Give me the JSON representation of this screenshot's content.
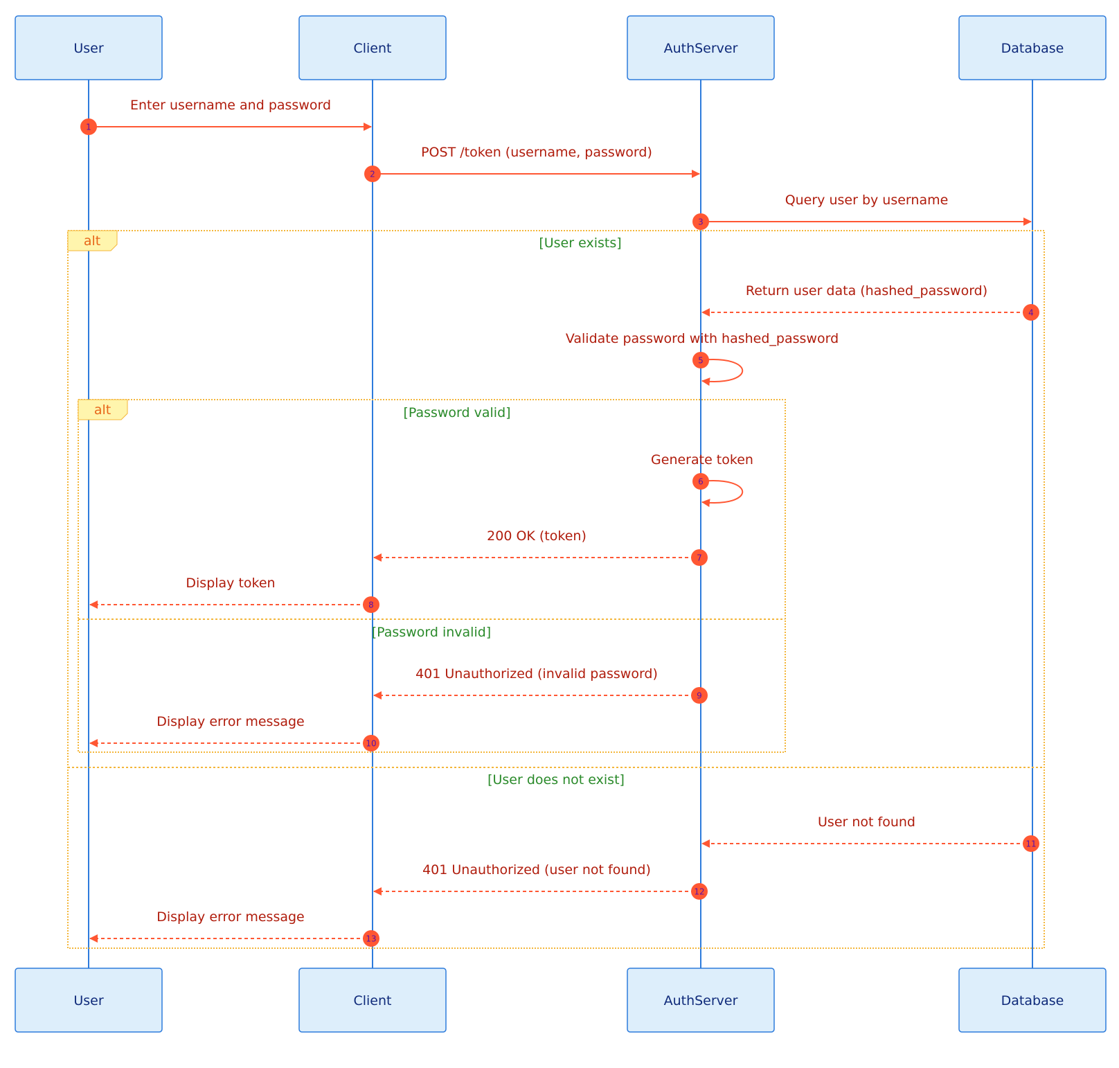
{
  "diagram": {
    "type": "sequence",
    "colors": {
      "actor_fill": "#ddeefb",
      "actor_border": "#2d7bdc",
      "lifeline": "#2d7bdc",
      "message": "#ff5733",
      "message_text": "#b01c0c",
      "sequence_number_text": "#5a0fa8",
      "fragment_border": "#f4b63a",
      "fragment_label_fill": "#fff5ad",
      "fragment_label_text": "#e8661a",
      "condition_text": "#2a8a2a"
    },
    "participants": [
      {
        "id": "User",
        "label": "User"
      },
      {
        "id": "Client",
        "label": "Client"
      },
      {
        "id": "AuthServer",
        "label": "AuthServer"
      },
      {
        "id": "Database",
        "label": "Database"
      }
    ],
    "messages": [
      {
        "num": "1",
        "from": "User",
        "to": "Client",
        "text": "Enter username and password",
        "style": "solid"
      },
      {
        "num": "2",
        "from": "Client",
        "to": "AuthServer",
        "text": "POST /token (username, password)",
        "style": "solid"
      },
      {
        "num": "3",
        "from": "AuthServer",
        "to": "Database",
        "text": "Query user by username",
        "style": "solid"
      },
      {
        "num": "4",
        "from": "Database",
        "to": "AuthServer",
        "text": "Return user data (hashed_password)",
        "style": "dashed"
      },
      {
        "num": "5",
        "from": "AuthServer",
        "to": "AuthServer",
        "text": "Validate password with hashed_password",
        "style": "solid"
      },
      {
        "num": "6",
        "from": "AuthServer",
        "to": "AuthServer",
        "text": "Generate token",
        "style": "solid"
      },
      {
        "num": "7",
        "from": "AuthServer",
        "to": "Client",
        "text": "200 OK (token)",
        "style": "dashed"
      },
      {
        "num": "8",
        "from": "Client",
        "to": "User",
        "text": "Display token",
        "style": "dashed"
      },
      {
        "num": "9",
        "from": "AuthServer",
        "to": "Client",
        "text": "401 Unauthorized (invalid password)",
        "style": "dashed"
      },
      {
        "num": "10",
        "from": "Client",
        "to": "User",
        "text": "Display error message",
        "style": "dashed"
      },
      {
        "num": "11",
        "from": "Database",
        "to": "AuthServer",
        "text": "User not found",
        "style": "dashed"
      },
      {
        "num": "12",
        "from": "AuthServer",
        "to": "Client",
        "text": "401 Unauthorized (user not found)",
        "style": "dashed"
      },
      {
        "num": "13",
        "from": "Client",
        "to": "User",
        "text": "Display error message",
        "style": "dashed"
      }
    ],
    "fragments": [
      {
        "kind": "alt",
        "label": "alt",
        "conditions": [
          "[User exists]",
          "[User does not exist]"
        ]
      },
      {
        "kind": "alt",
        "label": "alt",
        "conditions": [
          "[Password valid]",
          "[Password invalid]"
        ]
      }
    ]
  }
}
